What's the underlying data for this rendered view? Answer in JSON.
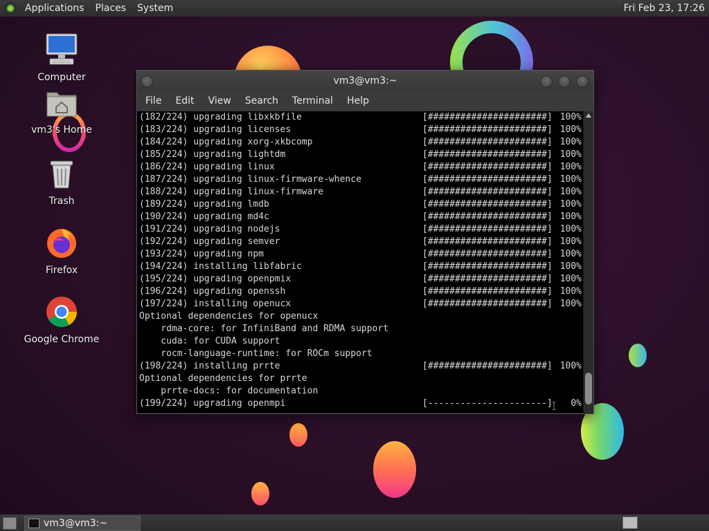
{
  "top_panel": {
    "menus": [
      "Applications",
      "Places",
      "System"
    ],
    "clock": "Fri Feb 23, 17:26"
  },
  "desktop_icons": [
    {
      "label": "Computer",
      "icon": "computer-icon"
    },
    {
      "label": "vm3's Home",
      "icon": "home-folder-icon"
    },
    {
      "label": "Trash",
      "icon": "trash-icon"
    },
    {
      "label": "Firefox",
      "icon": "firefox-icon"
    },
    {
      "label": "Google Chrome",
      "icon": "chrome-icon"
    }
  ],
  "window": {
    "title": "vm3@vm3:~",
    "menu": [
      "File",
      "Edit",
      "View",
      "Search",
      "Terminal",
      "Help"
    ]
  },
  "terminal": {
    "lines": [
      {
        "text": "(182/224) upgrading libxkbfile",
        "bar": "[######################]",
        "pct": "100%"
      },
      {
        "text": "(183/224) upgrading licenses",
        "bar": "[######################]",
        "pct": "100%"
      },
      {
        "text": "(184/224) upgrading xorg-xkbcomp",
        "bar": "[######################]",
        "pct": "100%"
      },
      {
        "text": "(185/224) upgrading lightdm",
        "bar": "[######################]",
        "pct": "100%"
      },
      {
        "text": "(186/224) upgrading linux",
        "bar": "[######################]",
        "pct": "100%"
      },
      {
        "text": "(187/224) upgrading linux-firmware-whence",
        "bar": "[######################]",
        "pct": "100%"
      },
      {
        "text": "(188/224) upgrading linux-firmware",
        "bar": "[######################]",
        "pct": "100%"
      },
      {
        "text": "(189/224) upgrading lmdb",
        "bar": "[######################]",
        "pct": "100%"
      },
      {
        "text": "(190/224) upgrading md4c",
        "bar": "[######################]",
        "pct": "100%"
      },
      {
        "text": "(191/224) upgrading nodejs",
        "bar": "[######################]",
        "pct": "100%"
      },
      {
        "text": "(192/224) upgrading semver",
        "bar": "[######################]",
        "pct": "100%"
      },
      {
        "text": "(193/224) upgrading npm",
        "bar": "[######################]",
        "pct": "100%"
      },
      {
        "text": "(194/224) installing libfabric",
        "bar": "[######################]",
        "pct": "100%"
      },
      {
        "text": "(195/224) upgrading openpmix",
        "bar": "[######################]",
        "pct": "100%"
      },
      {
        "text": "(196/224) upgrading openssh",
        "bar": "[######################]",
        "pct": "100%"
      },
      {
        "text": "(197/224) installing openucx",
        "bar": "[######################]",
        "pct": "100%"
      },
      {
        "text": "Optional dependencies for openucx",
        "bar": "",
        "pct": ""
      },
      {
        "text": "    rdma-core: for InfiniBand and RDMA support",
        "bar": "",
        "pct": ""
      },
      {
        "text": "    cuda: for CUDA support",
        "bar": "",
        "pct": ""
      },
      {
        "text": "    rocm-language-runtime: for ROCm support",
        "bar": "",
        "pct": ""
      },
      {
        "text": "(198/224) installing prrte",
        "bar": "[######################]",
        "pct": "100%"
      },
      {
        "text": "Optional dependencies for prrte",
        "bar": "",
        "pct": ""
      },
      {
        "text": "    prrte-docs: for documentation",
        "bar": "",
        "pct": ""
      },
      {
        "text": "(199/224) upgrading openmpi",
        "bar": "[----------------------]",
        "pct": "0%"
      }
    ]
  },
  "taskbar": {
    "task_label": "vm3@vm3:~"
  }
}
